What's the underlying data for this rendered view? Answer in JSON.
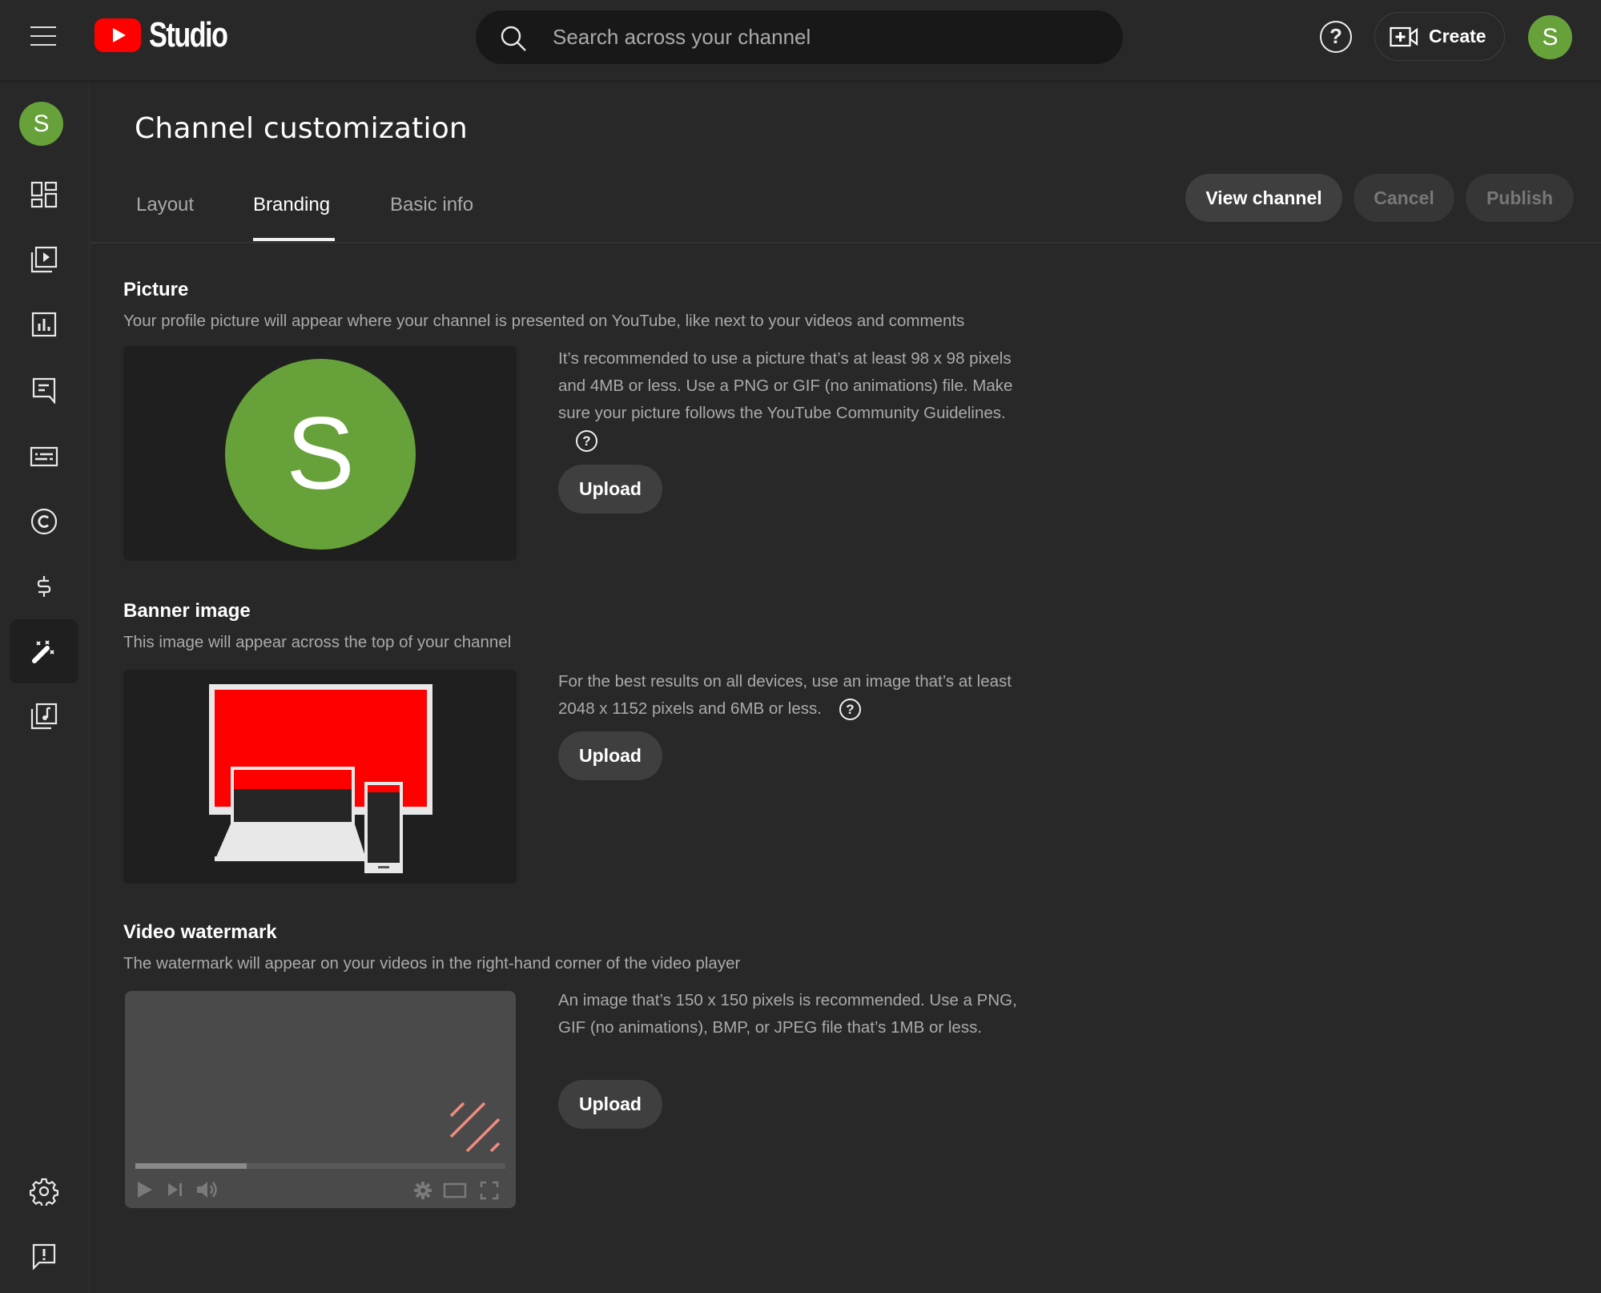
{
  "app": {
    "logo_text": "Studio",
    "search_placeholder": "Search across your channel",
    "create_label": "Create",
    "avatar_initial": "S",
    "brand_color": "#ff0000",
    "avatar_color": "#67a13a"
  },
  "sidebar": {
    "avatar_initial": "S",
    "items": [
      {
        "icon": "dashboard-icon",
        "label": "Dashboard"
      },
      {
        "icon": "content-icon",
        "label": "Content"
      },
      {
        "icon": "analytics-icon",
        "label": "Analytics"
      },
      {
        "icon": "comments-icon",
        "label": "Comments"
      },
      {
        "icon": "subtitles-icon",
        "label": "Subtitles"
      },
      {
        "icon": "copyright-icon",
        "label": "Copyright"
      },
      {
        "icon": "earn-icon",
        "label": "Earn"
      },
      {
        "icon": "customization-icon",
        "label": "Customization",
        "active": true
      },
      {
        "icon": "audio-library-icon",
        "label": "Audio library"
      }
    ],
    "bottom_items": [
      {
        "icon": "settings-icon",
        "label": "Settings"
      },
      {
        "icon": "feedback-icon",
        "label": "Send feedback"
      }
    ]
  },
  "page": {
    "title": "Channel customization",
    "tabs": [
      {
        "label": "Layout",
        "active": false
      },
      {
        "label": "Branding",
        "active": true
      },
      {
        "label": "Basic info",
        "active": false
      }
    ],
    "actions": {
      "view_channel": "View channel",
      "cancel": "Cancel",
      "publish": "Publish"
    }
  },
  "sections": {
    "picture": {
      "title": "Picture",
      "subtitle": "Your profile picture will appear where your channel is presented on YouTube, like next to your videos and comments",
      "preview_initial": "S",
      "description": "It’s recommended to use a picture that’s at least 98 x 98 pixels and 4MB or less. Use a PNG or GIF (no animations) file. Make sure your picture follows the YouTube Community Guidelines.",
      "upload_label": "Upload"
    },
    "banner": {
      "title": "Banner image",
      "subtitle": "This image will appear across the top of your channel",
      "description": "For the best results on all devices, use an image that’s at least 2048 x 1152 pixels and 6MB or less.",
      "upload_label": "Upload"
    },
    "watermark": {
      "title": "Video watermark",
      "subtitle": "The watermark will appear on your videos in the right-hand corner of the video player",
      "description": "An image that’s 150 x 150 pixels is recommended. Use a PNG, GIF (no animations), BMP, or JPEG file that’s 1MB or less.",
      "upload_label": "Upload",
      "player_progress_percent": 30
    }
  }
}
